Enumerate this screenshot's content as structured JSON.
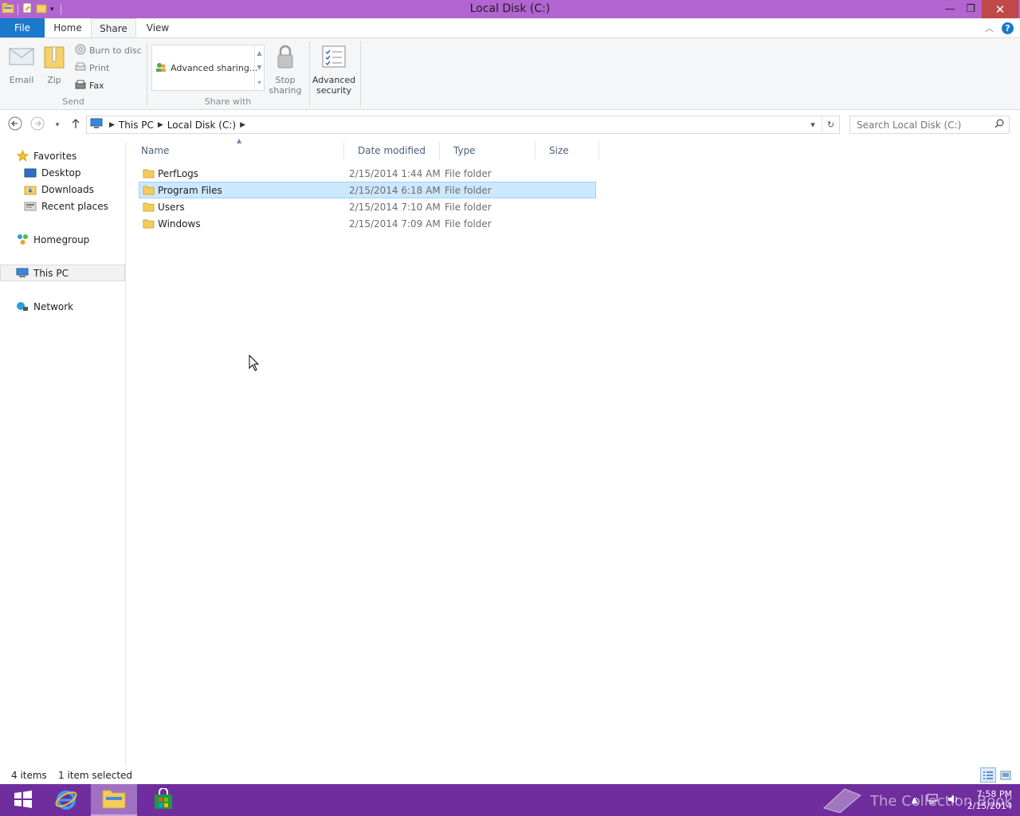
{
  "window": {
    "title": "Local Disk (C:)",
    "minimize_symbol": "—",
    "restore_symbol": "❐",
    "close_symbol": "✕"
  },
  "ribbon_tabs": {
    "file": "File",
    "home": "Home",
    "share": "Share",
    "view": "View",
    "active": "share",
    "help_symbol": "?"
  },
  "ribbon": {
    "send_group": {
      "label": "Send",
      "email": "Email",
      "zip": "Zip",
      "burn": "Burn to disc",
      "print": "Print",
      "fax": "Fax"
    },
    "share_with_group": {
      "label": "Share with",
      "gallery_item": "Advanced sharing...",
      "stop_sharing": [
        "Stop",
        "sharing"
      ]
    },
    "advanced_security": [
      "Advanced",
      "security"
    ]
  },
  "navigation": {
    "breadcrumbs": [
      "This PC",
      "Local Disk (C:)"
    ],
    "search_placeholder": "Search Local Disk (C:)"
  },
  "nav_pane": {
    "favorites": "Favorites",
    "desktop": "Desktop",
    "downloads": "Downloads",
    "recent_places": "Recent places",
    "homegroup": "Homegroup",
    "this_pc": "This PC",
    "network": "Network",
    "selected": "this_pc"
  },
  "file_list": {
    "columns": [
      "Name",
      "Date modified",
      "Type",
      "Size"
    ],
    "rows": [
      {
        "name": "PerfLogs",
        "date": "2/15/2014 1:44 AM",
        "type": "File folder",
        "size": ""
      },
      {
        "name": "Program Files",
        "date": "2/15/2014 6:18 AM",
        "type": "File folder",
        "size": "",
        "selected": true
      },
      {
        "name": "Users",
        "date": "2/15/2014 7:10 AM",
        "type": "File folder",
        "size": ""
      },
      {
        "name": "Windows",
        "date": "2/15/2014 7:09 AM",
        "type": "File folder",
        "size": ""
      }
    ]
  },
  "status": {
    "item_count": "4 items",
    "selection": "1 item selected"
  },
  "taskbar": {
    "clock_time": "7:58 PM",
    "clock_date": "2/15/2014",
    "watermark": "The Collection Book"
  },
  "colors": {
    "title_bar": "#b264d0",
    "file_tab": "#1979ca",
    "taskbar": "#6f2d9e",
    "selection": "#cce8ff",
    "close_button": "#c04848"
  }
}
